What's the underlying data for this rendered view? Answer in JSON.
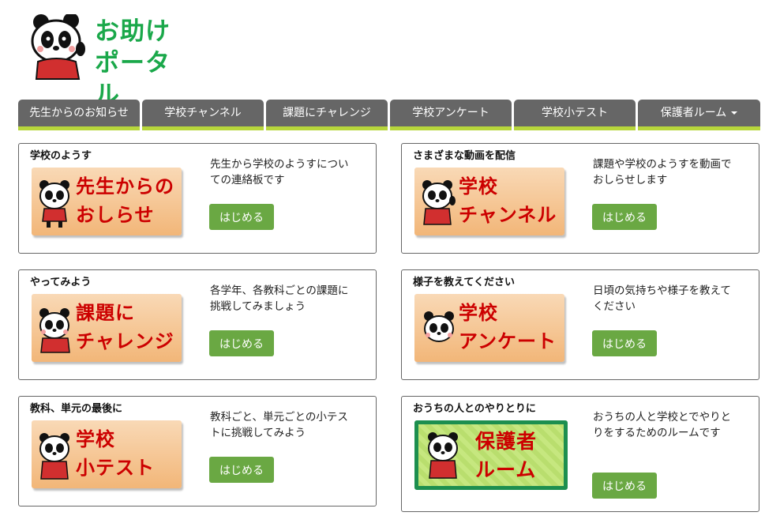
{
  "logo": {
    "line1": "お助け",
    "line2": "ポータル"
  },
  "nav": [
    "先生からのお知らせ",
    "学校チャンネル",
    "課題にチャレンジ",
    "学校アンケート",
    "学校小テスト",
    "保護者ルーム"
  ],
  "cards": [
    {
      "title": "学校のようす",
      "banner1": "先生からの",
      "banner2": "おしらせ",
      "desc": "先生から学校のようすについての連絡板です",
      "button": "はじめる"
    },
    {
      "title": "さまざまな動画を配信",
      "banner1": "学校",
      "banner2": "チャンネル",
      "desc": "課題や学校のようすを動画でおしらせします",
      "button": "はじめる"
    },
    {
      "title": "やってみよう",
      "banner1": "課題に",
      "banner2": "チャレンジ",
      "desc": "各学年、各教科ごとの課題に挑戦してみましょう",
      "button": "はじめる"
    },
    {
      "title": "様子を教えてください",
      "banner1": "学校",
      "banner2": "アンケート",
      "desc": "日頃の気持ちや様子を教えてください",
      "button": "はじめる"
    },
    {
      "title": "教科、単元の最後に",
      "banner1": "学校",
      "banner2": "小テスト",
      "desc": "教科ごと、単元ごとの小テストに挑戦してみよう",
      "button": "はじめる"
    },
    {
      "title": "おうちの人とのやりとりに",
      "banner1": "保護者",
      "banner2": "ルーム",
      "desc": "おうちの人と学校とでやりとりをするためのルームです",
      "button": "はじめる"
    }
  ],
  "colors": {
    "brand_green": "#1aa84a",
    "nav_bg": "#666666",
    "nav_accent": "#b7d63b",
    "button": "#6aa843",
    "banner_text": "#cc0000"
  }
}
